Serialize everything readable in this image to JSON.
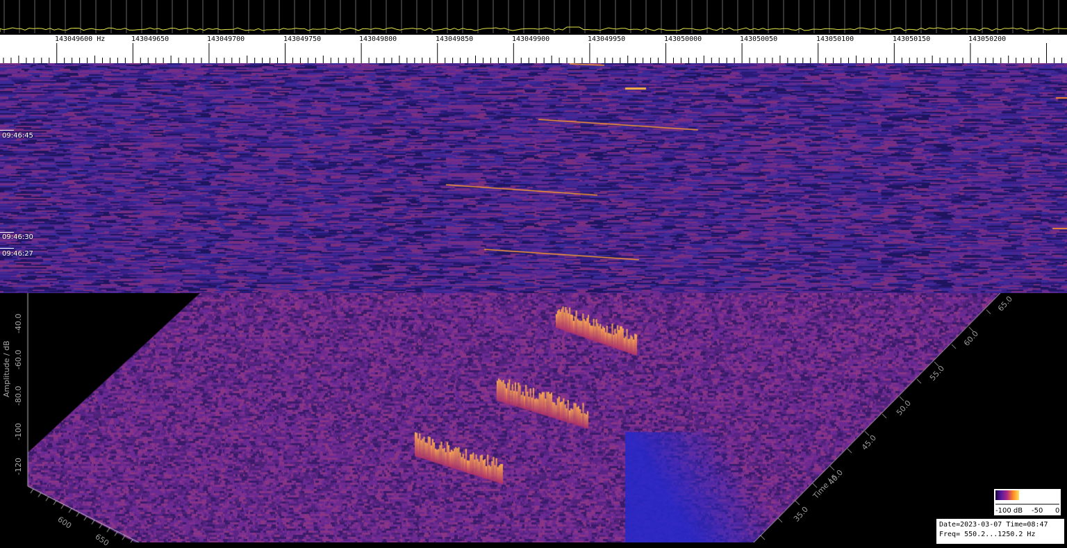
{
  "ruler": {
    "unit": "Hz",
    "labels": [
      "143049600",
      "143049650",
      "143049700",
      "143049750",
      "143049800",
      "143049850",
      "143049900",
      "143049950",
      "143050000",
      "143050050",
      "143050100",
      "143050150",
      "143050200"
    ]
  },
  "waterfall": {
    "time_labels": [
      "09:46:45",
      "09:46:30",
      "09:46:27"
    ]
  },
  "plot3d": {
    "amplitude_axis_label": "Amplitude / dB",
    "amplitude_ticks": [
      "-40.0",
      "-60.0",
      "-80.0",
      "-100",
      "-120"
    ],
    "time_axis_label": "Time / s",
    "time_ticks": [
      "35.0",
      "40.0",
      "45.0",
      "50.0",
      "55.0",
      "60.0",
      "65.0"
    ],
    "freq_ticks": [
      "600",
      "650"
    ]
  },
  "colorbar": {
    "label_low": "-100 dB",
    "label_mid": "-50",
    "label_high": "0"
  },
  "info": {
    "line1": "Date=2023-03-07 Time=08:47",
    "line2": "Freq= 550.2...1250.2 Hz"
  },
  "colors": {
    "background": "#000000",
    "noise_dark": "#2a1a6a",
    "noise_mid": "#6a2aa0",
    "signal": "#ff9a30",
    "spectrum_trace": "#e6e64a"
  }
}
